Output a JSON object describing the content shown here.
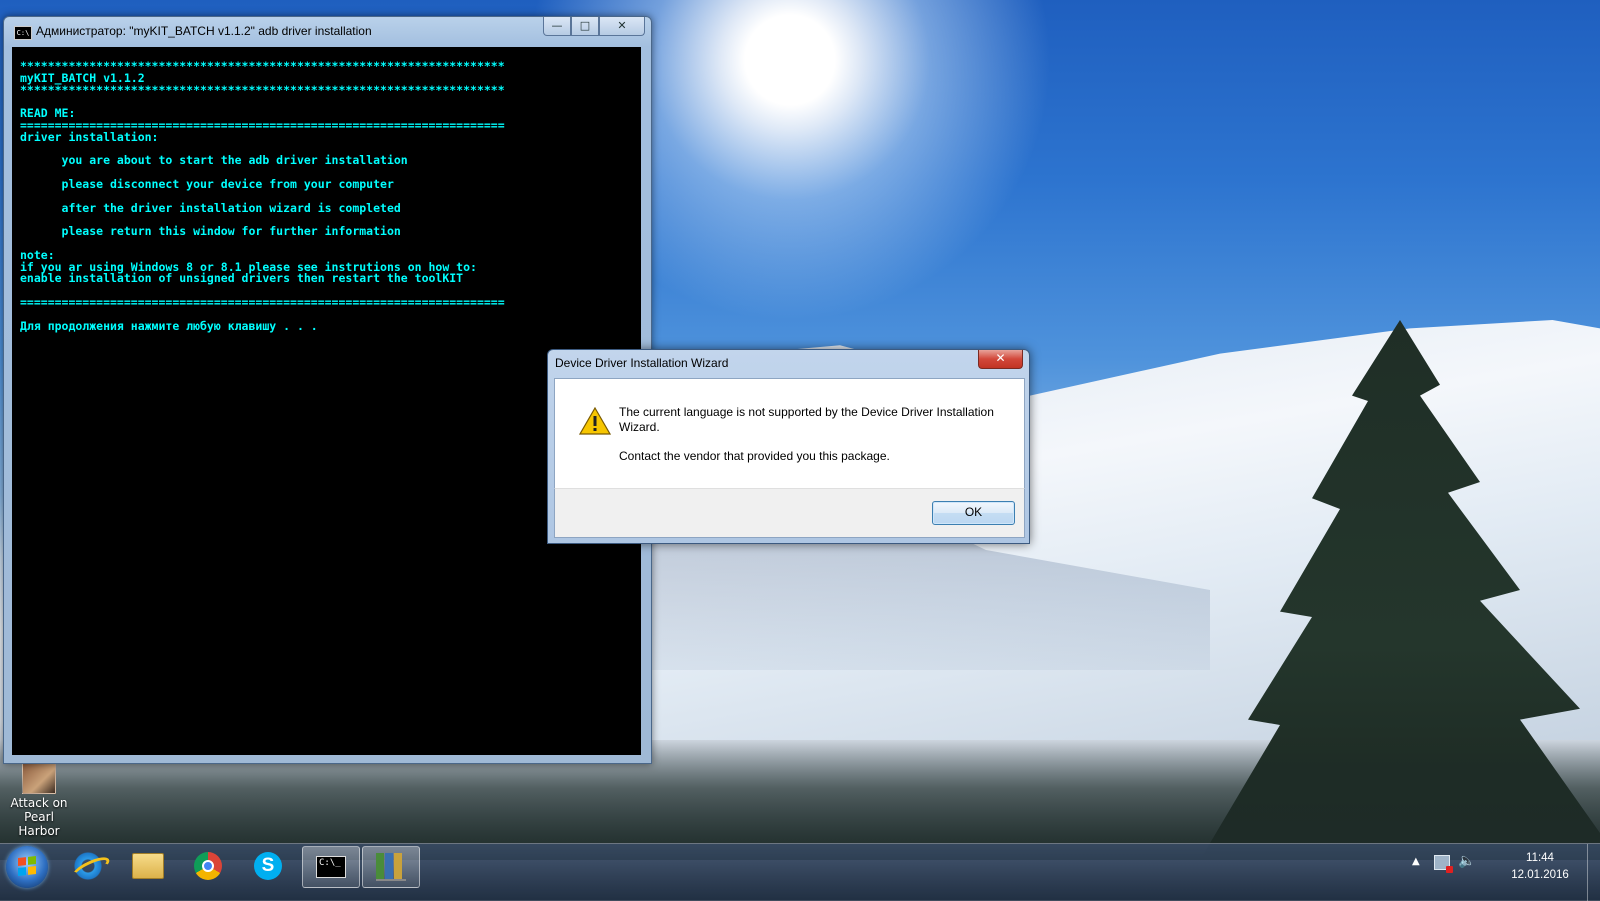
{
  "desktop": {
    "icons": [
      {
        "label_line1": "Attack on",
        "label_line2": "Pearl Harbor"
      }
    ]
  },
  "console": {
    "title": "Администратор:  \"myKIT_BATCH v1.1.2\" adb driver installation",
    "buttons": {
      "minimize": "—",
      "maximize": "□",
      "close": "✕"
    },
    "output": "**********************************************************************\nmyKIT_BATCH v1.1.2\n**********************************************************************\n\nREAD ME:\n======================================================================\ndriver installation:\n\n      you are about to start the adb driver installation\n\n      please disconnect your device from your computer\n\n      after the driver installation wizard is completed\n\n      please return this window for further information\n\nnote:\nif you ar using Windows 8 or 8.1 please see instrutions on how to:\nenable installation of unsigned drivers then restart the toolKIT\n\n======================================================================\n\nДля продолжения нажмите любую клавишу . . .",
    "colors": {
      "background": "#000000",
      "text": "#00ffff"
    }
  },
  "dialog": {
    "title": "Device Driver Installation Wizard",
    "close_label": "✕",
    "icon": "warning-icon",
    "message_line1": "The current language is not supported by the Device Driver Installation Wizard.",
    "message_line2": "Contact the vendor that provided you this package.",
    "ok_label": "OK"
  },
  "taskbar": {
    "items": [
      {
        "name": "start-button",
        "icon": "windows-logo-icon"
      },
      {
        "name": "internet-explorer",
        "icon": "internet-explorer-icon"
      },
      {
        "name": "windows-explorer",
        "icon": "folder-icon"
      },
      {
        "name": "google-chrome",
        "icon": "chrome-icon"
      },
      {
        "name": "skype",
        "icon": "skype-icon"
      },
      {
        "name": "command-prompt",
        "icon": "cmd-icon",
        "active": true
      },
      {
        "name": "driver-installer",
        "icon": "books-icon",
        "active": true
      }
    ],
    "tray": {
      "time": "11:44",
      "date": "12.01.2016",
      "icons": [
        "show-hidden-icons-chevron",
        "network-icon",
        "volume-icon"
      ]
    }
  }
}
